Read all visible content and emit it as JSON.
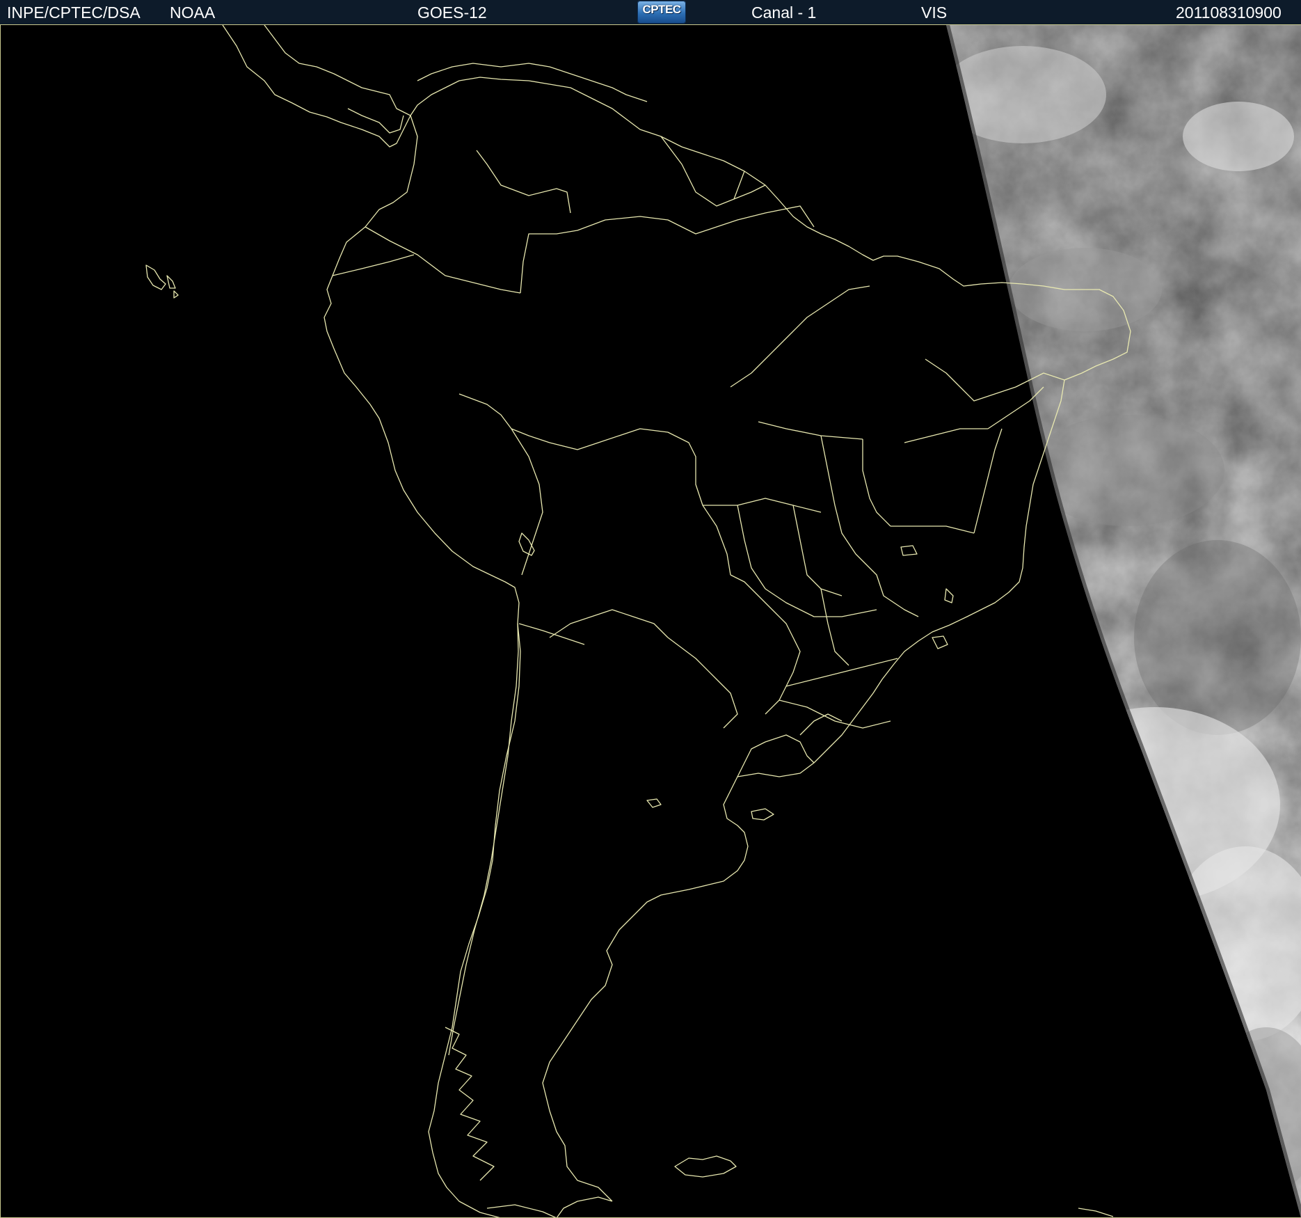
{
  "header": {
    "institution": "INPE/CPTEC/DSA",
    "agency": "NOAA",
    "satellite": "GOES-12",
    "logo_text": "CPTEC",
    "channel": "Canal - 1",
    "band": "VIS",
    "timestamp": "201108310900"
  },
  "map": {
    "coastline_color": "#e8e8b0",
    "background_color": "#000000",
    "header_bg_color": "#0d1b2a",
    "cloud_colors": [
      "#5a5a5a",
      "#8a8a8a",
      "#c8c8c8",
      "#e6e6e6"
    ]
  }
}
